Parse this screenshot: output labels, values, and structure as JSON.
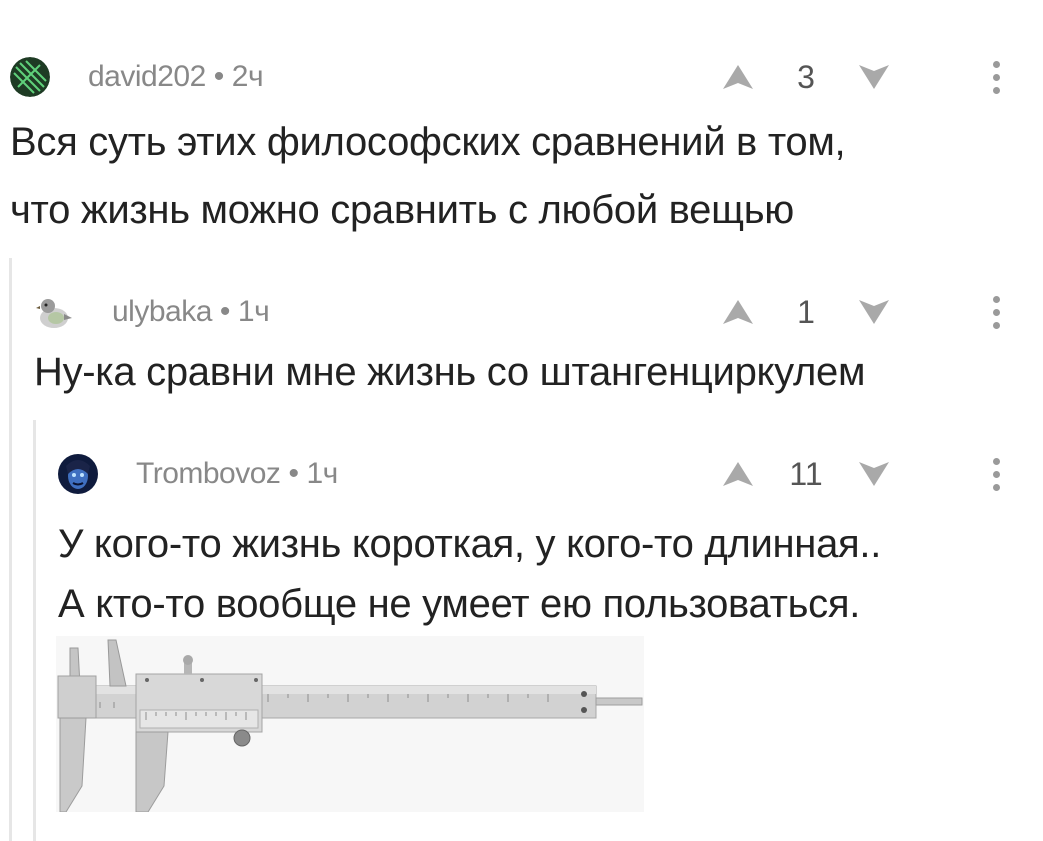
{
  "comments": [
    {
      "author": "david202",
      "separator": "•",
      "time": "2ч",
      "score": "3",
      "text_lines": [
        "Вся суть этих философских сравнений в том,",
        "что жизнь можно сравнить с любой вещью"
      ],
      "avatar_icon": "green-hatched-circle-avatar"
    },
    {
      "author": "ulybaka",
      "separator": "•",
      "time": "1ч",
      "score": "1",
      "text_lines": [
        "Ну-ка сравни мне жизнь со штангенциркулем"
      ],
      "avatar_icon": "pigeon-avatar"
    },
    {
      "author": "Trombovoz",
      "separator": "•",
      "time": "1ч",
      "score": "11",
      "text_lines": [
        "У кого-то жизнь короткая, у кого-то длинная..",
        "А кто-то вообще не умеет ею пользоваться."
      ],
      "avatar_icon": "blue-portrait-avatar",
      "attachment": "vernier-caliper-image"
    }
  ],
  "icons": {
    "upvote": "upvote-arrow-icon",
    "downvote": "downvote-arrow-icon",
    "more": "more-vertical-icon"
  },
  "colors": {
    "meta": "#888888",
    "text": "#222222",
    "arrows": "#a9a9a9",
    "thread_line": "#e6e6e6"
  }
}
